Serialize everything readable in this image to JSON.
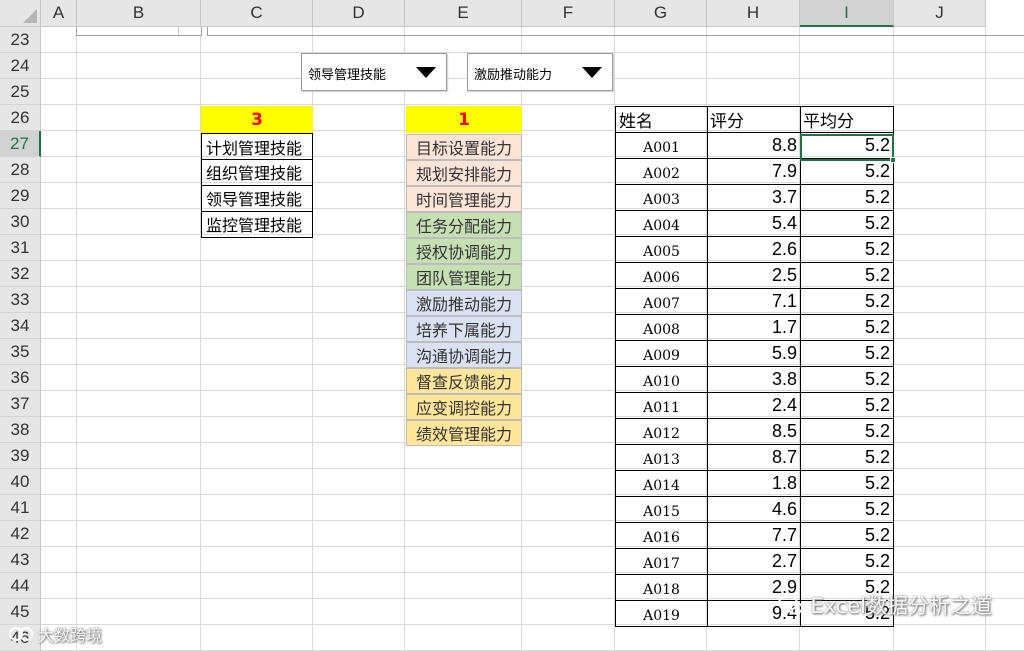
{
  "columns": [
    "A",
    "B",
    "C",
    "D",
    "E",
    "F",
    "G",
    "H",
    "I",
    "J"
  ],
  "selected_column": "I",
  "rows": [
    "23",
    "24",
    "25",
    "26",
    "27",
    "28",
    "29",
    "30",
    "31",
    "32",
    "33",
    "34",
    "35",
    "36",
    "37",
    "38",
    "39",
    "40",
    "41",
    "42",
    "43",
    "44",
    "45",
    "46"
  ],
  "selected_row": "27",
  "combo_left": {
    "value": "领导管理技能"
  },
  "combo_right": {
    "value": "激励推动能力"
  },
  "c_header": "3",
  "c_list": [
    "计划管理技能",
    "组织管理技能",
    "领导管理技能",
    "监控管理技能"
  ],
  "e_header": "1",
  "e_list": [
    {
      "text": "目标设置能力",
      "color": "#fce4d6"
    },
    {
      "text": "规划安排能力",
      "color": "#fce4d6"
    },
    {
      "text": "时间管理能力",
      "color": "#fce4d6"
    },
    {
      "text": "任务分配能力",
      "color": "#c6e0b4"
    },
    {
      "text": "授权协调能力",
      "color": "#c6e0b4"
    },
    {
      "text": "团队管理能力",
      "color": "#c6e0b4"
    },
    {
      "text": "激励推动能力",
      "color": "#d9e1f2"
    },
    {
      "text": "培养下属能力",
      "color": "#d9e1f2"
    },
    {
      "text": "沟通协调能力",
      "color": "#d9e1f2"
    },
    {
      "text": "督查反馈能力",
      "color": "#ffe699"
    },
    {
      "text": "应变调控能力",
      "color": "#ffe699"
    },
    {
      "text": "绩效管理能力",
      "color": "#ffe699"
    }
  ],
  "table": {
    "headers": [
      "姓名",
      "评分",
      "平均分"
    ],
    "rows": [
      [
        "A001",
        "8.8",
        "5.2"
      ],
      [
        "A002",
        "7.9",
        "5.2"
      ],
      [
        "A003",
        "3.7",
        "5.2"
      ],
      [
        "A004",
        "5.4",
        "5.2"
      ],
      [
        "A005",
        "2.6",
        "5.2"
      ],
      [
        "A006",
        "2.5",
        "5.2"
      ],
      [
        "A007",
        "7.1",
        "5.2"
      ],
      [
        "A008",
        "1.7",
        "5.2"
      ],
      [
        "A009",
        "5.9",
        "5.2"
      ],
      [
        "A010",
        "3.8",
        "5.2"
      ],
      [
        "A011",
        "2.4",
        "5.2"
      ],
      [
        "A012",
        "8.5",
        "5.2"
      ],
      [
        "A013",
        "8.7",
        "5.2"
      ],
      [
        "A014",
        "1.8",
        "5.2"
      ],
      [
        "A015",
        "4.6",
        "5.2"
      ],
      [
        "A016",
        "7.7",
        "5.2"
      ],
      [
        "A017",
        "2.7",
        "5.2"
      ],
      [
        "A018",
        "2.9",
        "5.2"
      ],
      [
        "A019",
        "9.4",
        "5.2"
      ]
    ]
  },
  "watermark_right": "Excel数据分析之道",
  "watermark_left": "大数跨境",
  "colors": {
    "accent": "#217346",
    "yellow": "#ffff00",
    "red": "#ff0000"
  }
}
